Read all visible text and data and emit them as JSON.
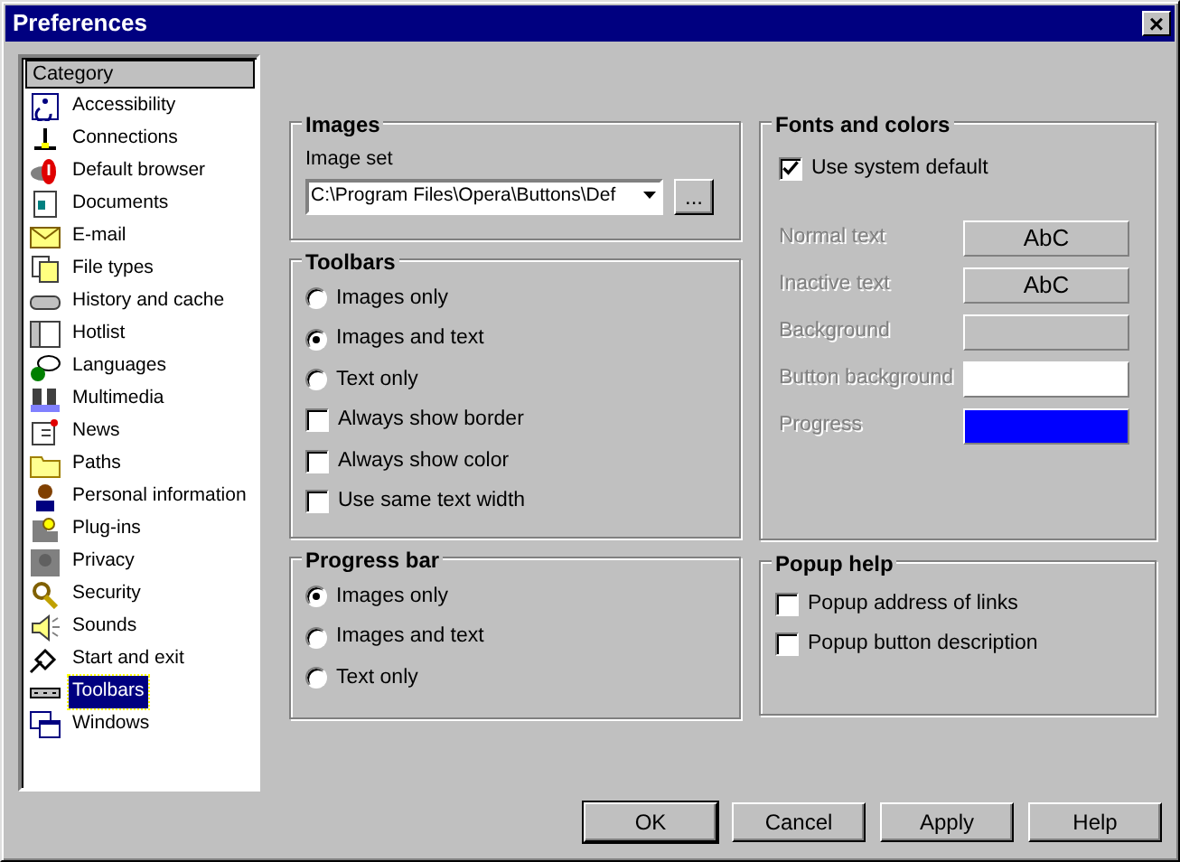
{
  "window": {
    "title": "Preferences",
    "close": "×"
  },
  "sidebar": {
    "header": "Category",
    "items": [
      {
        "label": "Accessibility",
        "selected": false
      },
      {
        "label": "Connections",
        "selected": false
      },
      {
        "label": "Default browser",
        "selected": false
      },
      {
        "label": "Documents",
        "selected": false
      },
      {
        "label": "E-mail",
        "selected": false
      },
      {
        "label": "File types",
        "selected": false
      },
      {
        "label": "History and cache",
        "selected": false
      },
      {
        "label": "Hotlist",
        "selected": false
      },
      {
        "label": "Languages",
        "selected": false
      },
      {
        "label": "Multimedia",
        "selected": false
      },
      {
        "label": "News",
        "selected": false
      },
      {
        "label": "Paths",
        "selected": false
      },
      {
        "label": "Personal information",
        "selected": false
      },
      {
        "label": "Plug-ins",
        "selected": false
      },
      {
        "label": "Privacy",
        "selected": false
      },
      {
        "label": "Security",
        "selected": false
      },
      {
        "label": "Sounds",
        "selected": false
      },
      {
        "label": "Start and exit",
        "selected": false
      },
      {
        "label": "Toolbars",
        "selected": true
      },
      {
        "label": "Windows",
        "selected": false
      }
    ]
  },
  "images": {
    "title": "Images",
    "label": "Image set",
    "value": "C:\\Program Files\\Opera\\Buttons\\Def",
    "browse": "..."
  },
  "toolbars": {
    "title": "Toolbars",
    "options": [
      {
        "kind": "radio",
        "label": "Images only",
        "checked": false
      },
      {
        "kind": "radio",
        "label": "Images and text",
        "checked": true
      },
      {
        "kind": "radio",
        "label": "Text only",
        "checked": false
      },
      {
        "kind": "checkbox",
        "label": "Always show border",
        "checked": false
      },
      {
        "kind": "checkbox",
        "label": "Always show color",
        "checked": false
      },
      {
        "kind": "checkbox",
        "label": "Use same text width",
        "checked": false
      }
    ]
  },
  "progress_bar": {
    "title": "Progress bar",
    "options": [
      {
        "kind": "radio",
        "label": "Images only",
        "checked": true
      },
      {
        "kind": "radio",
        "label": "Images and text",
        "checked": false
      },
      {
        "kind": "radio",
        "label": "Text only",
        "checked": false
      }
    ]
  },
  "fonts_and_colors": {
    "title": "Fonts and colors",
    "use_system_default": {
      "label": "Use system default",
      "checked": true
    },
    "rows": [
      {
        "kind": "font",
        "label": "Normal text",
        "sample": "AbC",
        "disabled": true
      },
      {
        "kind": "font",
        "label": "Inactive text",
        "sample": "AbC",
        "disabled": true
      },
      {
        "kind": "color",
        "label": "Background",
        "color": "#c0c0c0",
        "disabled": true
      },
      {
        "kind": "color",
        "label": "Button background",
        "color": "#ffffff",
        "disabled": true
      },
      {
        "kind": "color",
        "label": "Progress",
        "color": "#0000ff",
        "disabled": true
      }
    ]
  },
  "popup_help": {
    "title": "Popup help",
    "options": [
      {
        "kind": "checkbox",
        "label": "Popup address of links",
        "checked": false
      },
      {
        "kind": "checkbox",
        "label": "Popup button description",
        "checked": false
      }
    ]
  },
  "buttons": [
    {
      "label": "OK",
      "default": true
    },
    {
      "label": "Cancel",
      "default": false
    },
    {
      "label": "Apply",
      "default": false
    },
    {
      "label": "Help",
      "default": false
    }
  ]
}
